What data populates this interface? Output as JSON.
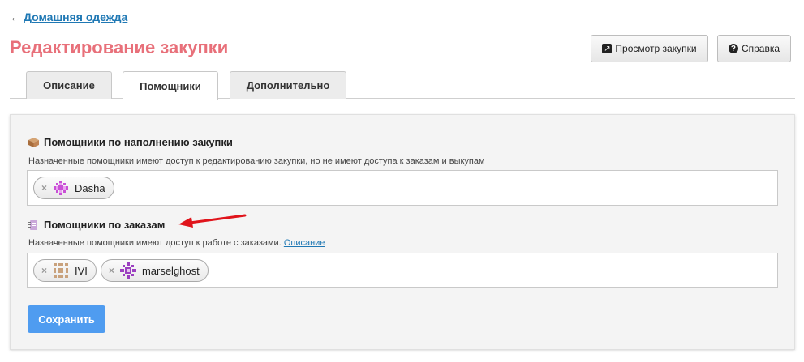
{
  "breadcrumb": {
    "arrow": "←",
    "link": "Домашняя одежда"
  },
  "page_title": "Редактирование закупки",
  "header_buttons": {
    "view": "Просмотр закупки",
    "help": "Справка"
  },
  "tabs": [
    {
      "label": "Описание",
      "active": false
    },
    {
      "label": "Помощники",
      "active": true
    },
    {
      "label": "Дополнительно",
      "active": false
    }
  ],
  "sections": {
    "filling": {
      "title": "Помощники по наполнению закупки",
      "description": "Назначенные помощники имеют доступ к редактированию закупки, но не имеют доступа к заказам и выкупам",
      "chips": [
        {
          "name": "Dasha",
          "remove": "×",
          "avatar_color": "#c94fd6"
        }
      ]
    },
    "orders": {
      "title": "Помощники по заказам",
      "description": "Назначенные помощники имеют доступ к работе с заказами.",
      "link": "Описание",
      "chips": [
        {
          "name": "IVI",
          "remove": "×",
          "avatar_color": "#c9a27d"
        },
        {
          "name": "marselghost",
          "remove": "×",
          "avatar_color": "#9b3fc0"
        }
      ]
    }
  },
  "save_label": "Сохранить",
  "colors": {
    "title": "#e8707a",
    "link": "#1f78b4",
    "save": "#4f9cf0",
    "annotation_arrow": "#e0141b"
  }
}
